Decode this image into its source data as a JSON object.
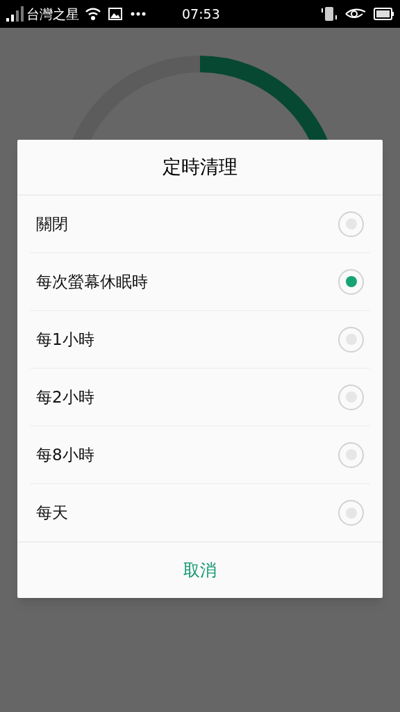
{
  "status_bar": {
    "carrier": "台灣之星",
    "time": "07:53"
  },
  "dialog": {
    "title": "定時清理",
    "options": [
      {
        "label": "關閉",
        "selected": false
      },
      {
        "label": "每次螢幕休眠時",
        "selected": true
      },
      {
        "label": "每1小時",
        "selected": false
      },
      {
        "label": "每2小時",
        "selected": false
      },
      {
        "label": "每8小時",
        "selected": false
      },
      {
        "label": "每天",
        "selected": false
      }
    ],
    "cancel": "取消"
  }
}
